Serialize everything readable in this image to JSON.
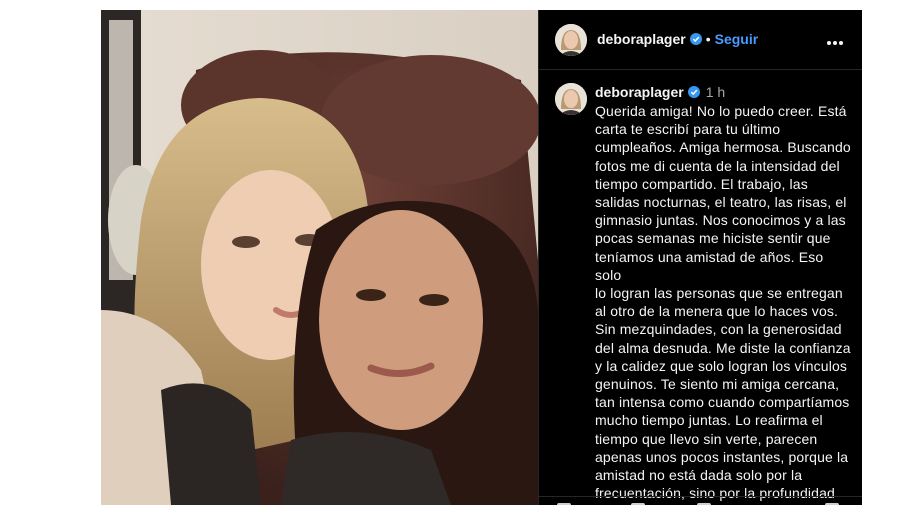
{
  "post": {
    "username": "deboraplager",
    "follow_label": "Seguir",
    "separator": "•",
    "time_ago": "1 h",
    "caption": "Querida amiga! No lo puedo creer. Está\ncarta te escribí para tu último\ncumpleaños. Amiga hermosa. Buscando\nfotos me di cuenta de la intensidad del\ntiempo compartido. El trabajo, las\nsalidas nocturnas, el teatro, las risas, el\ngimnasio juntas. Nos conocimos y a las\npocas semanas me hiciste sentir que\nteníamos una amistad de años. Eso solo\nlo logran las personas que se entregan\nal otro de la menera que lo haces vos.\nSin mezquindades, con la generosidad\ndel alma desnuda. Me diste la confianza\ny la calidez que solo logran los vínculos\ngenuinos. Te siento mi amiga cercana,\ntan intensa como cuando compartíamos\nmucho tiempo juntas. Lo reafirma el\ntiempo que llevo sin verte, parecen\napenas unos pocos instantes, porque la\namistad no está dada solo por la\nfrecuentación, sino por la profundidad\ndel amor compartido. Te quiero mucho"
  },
  "icons": {
    "verified": "verified-badge-icon",
    "more": "more-options-icon"
  },
  "colors": {
    "panel_bg": "#000000",
    "text": "#f5f5f5",
    "follow": "#4a9bff",
    "verified": "#3897f0",
    "muted": "#a8a8a8"
  }
}
